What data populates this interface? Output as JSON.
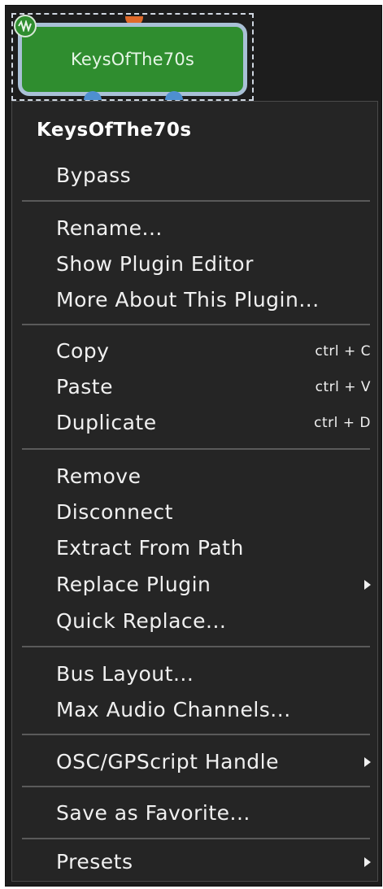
{
  "node": {
    "label": "KeysOfThe70s",
    "fill_color": "#2f8d2f",
    "border_color": "#a9c0d6",
    "input_pin_color": "#e06a2a",
    "output_pin_color": "#4e8fd0",
    "badge_icon": "waveform-icon"
  },
  "menu": {
    "title": "KeysOfThe70s",
    "bypass": "Bypass",
    "rename": "Rename...",
    "show_editor": "Show Plugin Editor",
    "more_about": "More About This Plugin...",
    "copy": "Copy",
    "copy_shortcut": "ctrl + C",
    "paste": "Paste",
    "paste_shortcut": "ctrl + V",
    "duplicate": "Duplicate",
    "duplicate_shortcut": "ctrl + D",
    "remove": "Remove",
    "disconnect": "Disconnect",
    "extract": "Extract From Path",
    "replace": "Replace Plugin",
    "quick_replace": "Quick Replace...",
    "bus_layout": "Bus Layout...",
    "max_audio": "Max Audio Channels...",
    "osc_handle": "OSC/GPScript Handle",
    "save_favorite": "Save as Favorite...",
    "presets": "Presets",
    "submenu_icon": "submenu-arrow-icon"
  }
}
